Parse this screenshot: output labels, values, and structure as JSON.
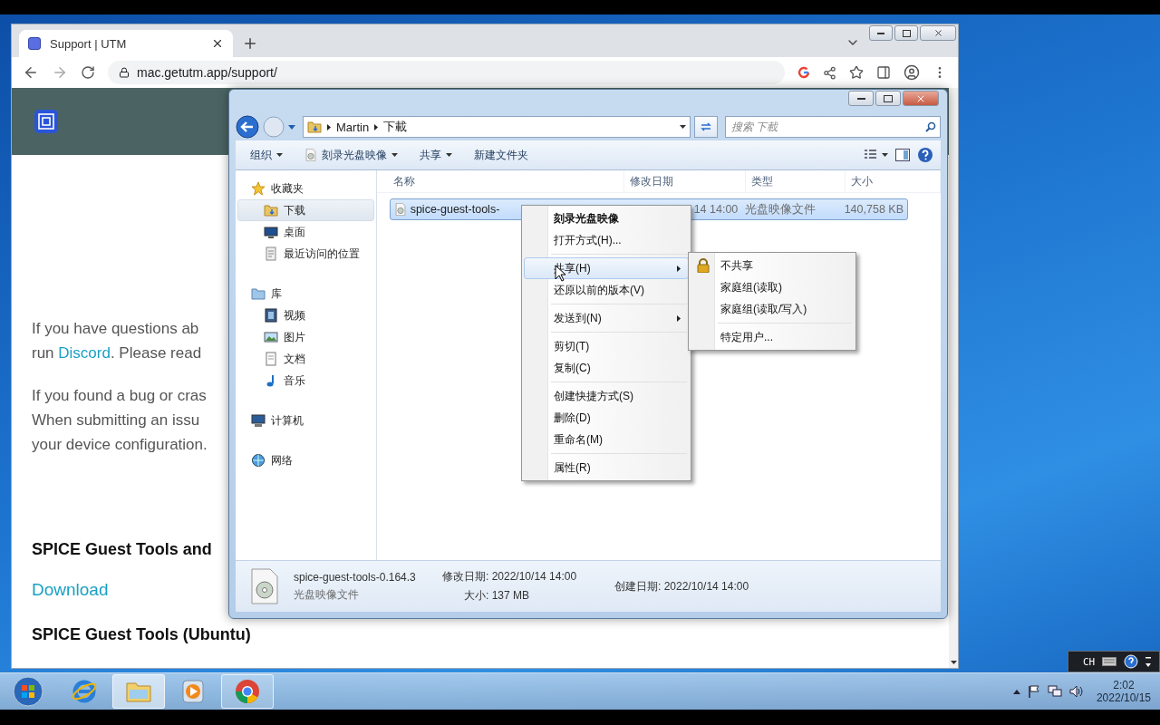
{
  "browser": {
    "tab": {
      "title": "Support | UTM",
      "selected": true
    },
    "address": "mac.getutm.app/support/",
    "blocks": [
      {
        "kind": "paragraph",
        "lines": [
          [
            {
              "text": "If you have questions ab",
              "kind": "text"
            }
          ],
          [
            {
              "text": "run ",
              "kind": "text"
            },
            {
              "text": "Discord",
              "kind": "link"
            },
            {
              "text": ". Please read",
              "kind": "text"
            }
          ]
        ]
      },
      {
        "kind": "paragraph",
        "lines": [
          [
            {
              "text": "If you found a bug or cras",
              "kind": "text"
            }
          ],
          [
            {
              "text": "When submitting an issu",
              "kind": "text"
            }
          ],
          [
            {
              "text": "your device configuration.",
              "kind": "text"
            }
          ]
        ]
      },
      {
        "kind": "heading",
        "text": "SPICE Guest Tools and"
      },
      {
        "kind": "link",
        "text": "Download"
      },
      {
        "kind": "heading",
        "text": "SPICE Guest Tools (Ubuntu)"
      }
    ]
  },
  "explorer": {
    "breadcrumb": [
      "Martin",
      "下載"
    ],
    "search_placeholder": "搜索 下載",
    "toolbar": [
      {
        "label": "组织",
        "dropdown": true,
        "icon": false
      },
      {
        "label": "刻录光盘映像",
        "dropdown": true,
        "icon": true
      },
      {
        "label": "共享",
        "dropdown": true,
        "icon": false
      },
      {
        "label": "新建文件夹",
        "dropdown": false,
        "icon": false
      }
    ],
    "sidebar": [
      {
        "label": "收藏夹",
        "kind": "star",
        "selected": false,
        "children": [
          {
            "label": "下载",
            "kind": "folder",
            "selected": true
          },
          {
            "label": "桌面",
            "kind": "desktop",
            "selected": false
          },
          {
            "label": "最近访问的位置",
            "kind": "recent",
            "selected": false
          }
        ]
      },
      {
        "label": "库",
        "kind": "library",
        "selected": false,
        "children": [
          {
            "label": "视频",
            "kind": "video",
            "selected": false
          },
          {
            "label": "图片",
            "kind": "picture",
            "selected": false
          },
          {
            "label": "文档",
            "kind": "document",
            "selected": false
          },
          {
            "label": "音乐",
            "kind": "music",
            "selected": false
          }
        ]
      },
      {
        "label": "计算机",
        "kind": "computer",
        "selected": false
      },
      {
        "label": "网络",
        "kind": "network",
        "selected": false
      }
    ],
    "columns": [
      "名称",
      "修改日期",
      "类型",
      "大小"
    ],
    "rows": [
      {
        "name": "spice-guest-tools-",
        "modified": "14 14:00",
        "type": "光盘映像文件",
        "size": "140,758 KB",
        "selected": true
      }
    ],
    "context_menu": {
      "groups": [
        [
          {
            "label": "刻录光盘映像",
            "bold": true,
            "selected": false,
            "submenu": false
          },
          {
            "label": "打开方式(H)...",
            "bold": false,
            "selected": false,
            "submenu": false
          }
        ],
        [
          {
            "label": "共享(H)",
            "bold": false,
            "selected": true,
            "submenu": true
          },
          {
            "label": "还原以前的版本(V)",
            "bold": false,
            "selected": false,
            "submenu": false
          }
        ],
        [
          {
            "label": "发送到(N)",
            "bold": false,
            "selected": false,
            "submenu": true
          }
        ],
        [
          {
            "label": "剪切(T)",
            "bold": false,
            "selected": false,
            "submenu": false
          },
          {
            "label": "复制(C)",
            "bold": false,
            "selected": false,
            "submenu": false
          }
        ],
        [
          {
            "label": "创建快捷方式(S)",
            "bold": false,
            "selected": false,
            "submenu": false
          },
          {
            "label": "删除(D)",
            "bold": false,
            "selected": false,
            "submenu": false
          },
          {
            "label": "重命名(M)",
            "bold": false,
            "selected": false,
            "submenu": false
          }
        ],
        [
          {
            "label": "属性(R)",
            "bold": false,
            "selected": false,
            "submenu": false
          }
        ]
      ]
    },
    "submenu": {
      "groups": [
        [
          {
            "label": "不共享",
            "lock": true,
            "selected": false
          },
          {
            "label": "家庭组(读取)",
            "lock": false,
            "selected": false
          },
          {
            "label": "家庭组(读取/写入)",
            "lock": false,
            "selected": false
          }
        ],
        [
          {
            "label": "特定用户...",
            "lock": false,
            "selected": false
          }
        ]
      ]
    },
    "details": {
      "name": "spice-guest-tools-0.164.3",
      "type": "光盘映像文件",
      "modified": "修改日期: 2022/10/14 14:00",
      "size": "大小: 137 MB",
      "created": "创建日期: 2022/10/14 14:00"
    }
  },
  "taskbar": {
    "apps": [
      {
        "kind": "ie",
        "selected": false,
        "running": false
      },
      {
        "kind": "explorer",
        "selected": true,
        "running": true
      },
      {
        "kind": "media",
        "selected": false,
        "running": false
      },
      {
        "kind": "chrome",
        "selected": false,
        "running": true
      }
    ],
    "time": "2:02",
    "date": "2022/10/15",
    "language": "CH"
  }
}
